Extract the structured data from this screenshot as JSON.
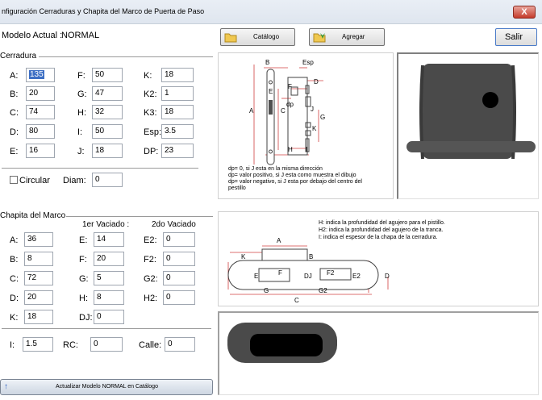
{
  "window": {
    "title": "nfiguración Cerraduras y Chapita del Marco de Puerta de Paso",
    "close_glyph": "X"
  },
  "model": {
    "label": "Modelo Actual :",
    "value": "NORMAL"
  },
  "toolbar": {
    "catalog_label": "Catálogo",
    "add_label": "Agregar",
    "exit_label": "Salir"
  },
  "cerradura": {
    "legend": "Cerradura",
    "fields": [
      {
        "label": "A:",
        "value": "135"
      },
      {
        "label": "F:",
        "value": "50"
      },
      {
        "label": "K:",
        "value": "18"
      },
      {
        "label": "B:",
        "value": "20"
      },
      {
        "label": "G:",
        "value": "47"
      },
      {
        "label": "K2:",
        "value": "1"
      },
      {
        "label": "C:",
        "value": "74"
      },
      {
        "label": "H:",
        "value": "32"
      },
      {
        "label": "K3:",
        "value": "18"
      },
      {
        "label": "D:",
        "value": "80"
      },
      {
        "label": "I:",
        "value": "50"
      },
      {
        "label": "Esp:",
        "value": "3.5"
      },
      {
        "label": "E:",
        "value": "16"
      },
      {
        "label": "J:",
        "value": "18"
      },
      {
        "label": "DP:",
        "value": "23"
      }
    ],
    "circular_label": "Circular",
    "diam_label": "Diam:",
    "diam_value": "0"
  },
  "chapita": {
    "legend": "Chapita del Marco",
    "col1_header": "1er Vaciado :",
    "col2_header": "2do Vaciado",
    "fields": [
      {
        "label": "A:",
        "value": "36"
      },
      {
        "label": "E:",
        "value": "14"
      },
      {
        "label": "E2:",
        "value": "0"
      },
      {
        "label": "B:",
        "value": "8"
      },
      {
        "label": "F:",
        "value": "20"
      },
      {
        "label": "F2:",
        "value": "0"
      },
      {
        "label": "C:",
        "value": "72"
      },
      {
        "label": "G:",
        "value": "5"
      },
      {
        "label": "G2:",
        "value": "0"
      },
      {
        "label": "D:",
        "value": "20"
      },
      {
        "label": "H:",
        "value": "8"
      },
      {
        "label": "H2:",
        "value": "0"
      },
      {
        "label": "K:",
        "value": "18"
      },
      {
        "label": "DJ:",
        "value": "0"
      }
    ],
    "i_label": "I:",
    "i_value": "1.5",
    "rc_label": "RC:",
    "rc_value": "0",
    "calle_label": "Calle:",
    "calle_value": "0"
  },
  "lock_diagram": {
    "labels": {
      "b": "B",
      "esp": "Esp",
      "d": "D",
      "e": "E",
      "f": "F",
      "a": "A",
      "c": "C",
      "dp": "dp",
      "j": "J",
      "g": "G",
      "k": "K",
      "h": "H",
      "i": "I"
    },
    "notes": [
      "dp= 0, si J esta en la misma dirección",
      "dp= valor positivo, si J esta como muestra el dibujo",
      "dp= valor negativo, si J esta por debajo del centro del",
      "pestillo"
    ]
  },
  "strike_diagram": {
    "notes": [
      "H: indica la profundidad del agujero para el pistillo.",
      "H2: indica la profundidad del agujero de la tranca.",
      "I: indica el espesor de la chapa de la cerradura."
    ],
    "labels": {
      "a": "A",
      "k": "K",
      "b": "B",
      "e": "E",
      "f": "F",
      "dj": "DJ",
      "f2": "F2",
      "e2": "E2",
      "d": "D",
      "g": "G",
      "g2": "G2",
      "c": "C"
    }
  },
  "statusbar": {
    "label": "Actualizar Modelo NORMAL en Catálogo"
  },
  "colors": {
    "preview_dark": "#4a4a4a",
    "accent_blue": "#3d6fc4",
    "dim_red": "#d04040"
  }
}
